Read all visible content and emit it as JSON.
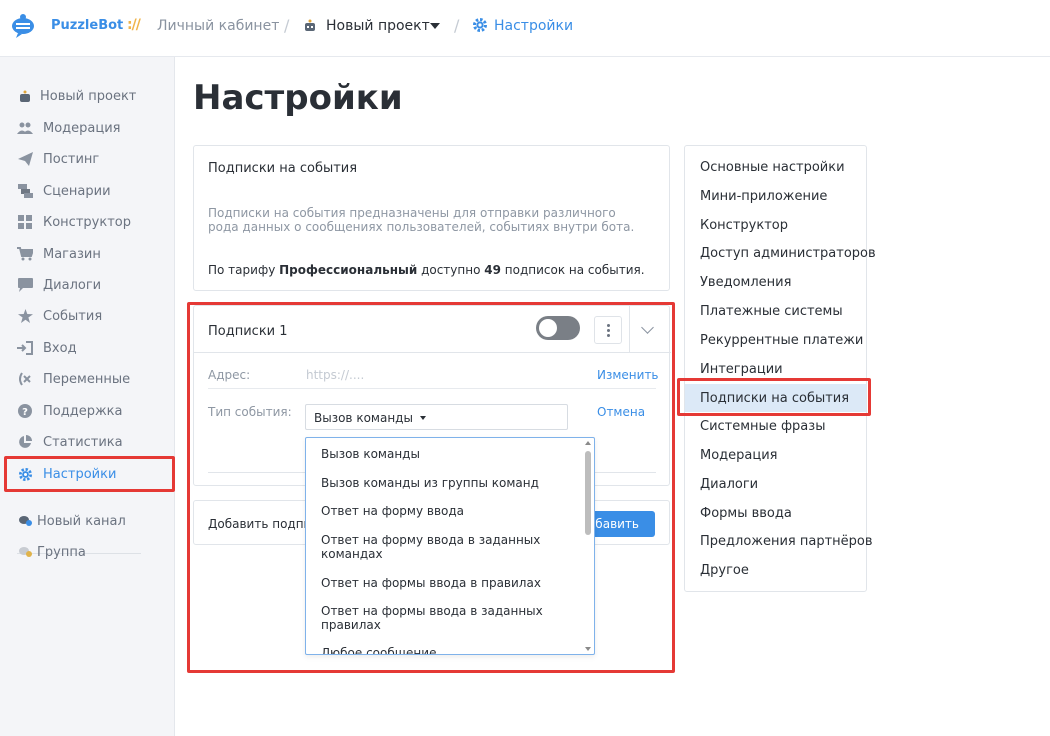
{
  "header": {
    "brand": "PuzzleBot",
    "brand_sep": "://",
    "crumbs": {
      "cabinet": "Личный кабинет",
      "project": "Новый проект",
      "settings": "Настройки"
    }
  },
  "sidebar": {
    "items": [
      {
        "label": "Новый проект",
        "icon": "robot-icon"
      },
      {
        "label": "Модерация",
        "icon": "users-icon"
      },
      {
        "label": "Постинг",
        "icon": "paper-plane-icon"
      },
      {
        "label": "Сценарии",
        "icon": "scenarios-icon"
      },
      {
        "label": "Конструктор",
        "icon": "grid-icon"
      },
      {
        "label": "Магазин",
        "icon": "cart-icon"
      },
      {
        "label": "Диалоги",
        "icon": "chat-icon"
      },
      {
        "label": "События",
        "icon": "star-icon"
      },
      {
        "label": "Вход",
        "icon": "sign-in-icon"
      },
      {
        "label": "Переменные",
        "icon": "variable-icon"
      },
      {
        "label": "Поддержка",
        "icon": "question-icon"
      },
      {
        "label": "Статистика",
        "icon": "pie-chart-icon"
      },
      {
        "label": "Настройки",
        "icon": "gear-icon"
      }
    ],
    "channels": [
      {
        "label": "Новый канал",
        "icon": "channel-icon"
      },
      {
        "label": "Группа",
        "icon": "group-icon"
      }
    ]
  },
  "page": {
    "title": "Настройки"
  },
  "info_card": {
    "title": "Подписки на события",
    "description": "Подписки на события предназначены для отправки различного рода данных о сообщениях пользователей, событиях внутри бота.",
    "plan_prefix": "По тарифу ",
    "plan_name": "Профессиональный",
    "plan_middle": " доступно ",
    "plan_count": "49",
    "plan_suffix": " подписок на события."
  },
  "subscription": {
    "title": "Подписки 1",
    "toggle_on": false,
    "address_label": "Адрес:",
    "address_placeholder": "https://....",
    "change_link": "Изменить",
    "event_type_label": "Тип события:",
    "event_type_value": "Вызов команды",
    "cancel_link": "Отмена"
  },
  "add_row": {
    "label": "Добавить подписку",
    "button": "Добавить"
  },
  "dropdown": {
    "options": [
      "Вызов команды",
      "Вызов команды из группы команд",
      "Ответ на форму ввода",
      "Ответ на форму ввода в заданных командах",
      "Ответ на формы ввода в правилах",
      "Ответ на формы ввода в заданных правилах",
      "Любое сообщение"
    ]
  },
  "right_nav": {
    "items": [
      "Основные настройки",
      "Мини-приложение",
      "Конструктор",
      "Доступ администраторов",
      "Уведомления",
      "Платежные системы",
      "Рекуррентные платежи",
      "Интеграции",
      "Подписки на события",
      "Системные фразы",
      "Модерация",
      "Диалоги",
      "Формы ввода",
      "Предложения партнёров",
      "Другое"
    ],
    "active": "Подписки на события"
  },
  "colors": {
    "accent": "#3a8ee6",
    "highlight": "#e53935",
    "active_bg": "#dce9f7"
  }
}
